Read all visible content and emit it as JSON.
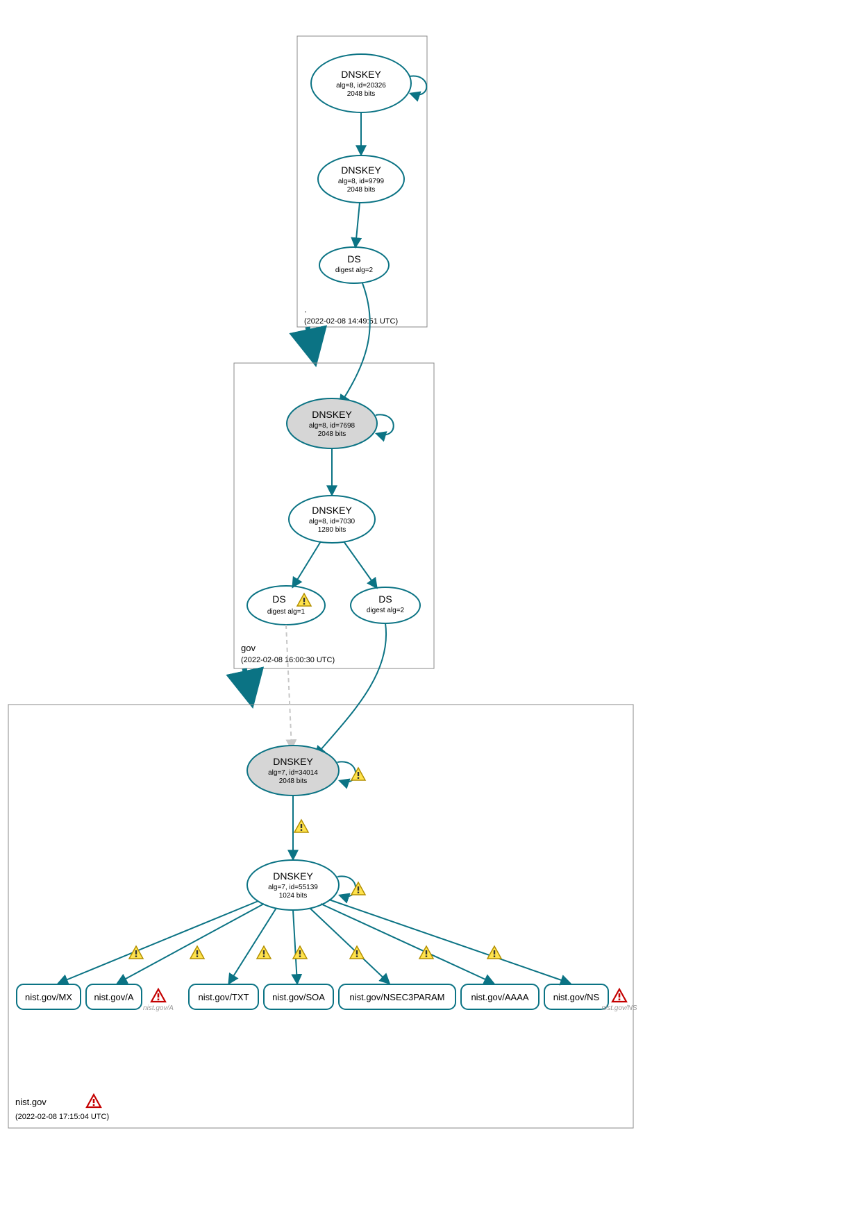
{
  "colors": {
    "line": "#0b7384",
    "shade": "#d6d6d6"
  },
  "zones": {
    "root": {
      "label": ".",
      "timestamp": "(2022-02-08 14:49:51 UTC)"
    },
    "gov": {
      "label": "gov",
      "timestamp": "(2022-02-08 16:00:30 UTC)"
    },
    "nist": {
      "label": "nist.gov",
      "timestamp": "(2022-02-08 17:15:04 UTC)"
    }
  },
  "nodes": {
    "root_ksk": {
      "title": "DNSKEY",
      "sub1": "alg=8, id=20326",
      "sub2": "2048 bits"
    },
    "root_zsk": {
      "title": "DNSKEY",
      "sub1": "alg=8, id=9799",
      "sub2": "2048 bits"
    },
    "root_ds": {
      "title": "DS",
      "sub1": "digest alg=2"
    },
    "gov_ksk": {
      "title": "DNSKEY",
      "sub1": "alg=8, id=7698",
      "sub2": "2048 bits"
    },
    "gov_zsk": {
      "title": "DNSKEY",
      "sub1": "alg=8, id=7030",
      "sub2": "1280 bits"
    },
    "gov_ds1": {
      "title": "DS",
      "sub1": "digest alg=1"
    },
    "gov_ds2": {
      "title": "DS",
      "sub1": "digest alg=2"
    },
    "nist_ksk": {
      "title": "DNSKEY",
      "sub1": "alg=7, id=34014",
      "sub2": "2048 bits"
    },
    "nist_zsk": {
      "title": "DNSKEY",
      "sub1": "alg=7, id=55139",
      "sub2": "1024 bits"
    }
  },
  "leaves": {
    "mx": "nist.gov/MX",
    "a": "nist.gov/A",
    "txt": "nist.gov/TXT",
    "soa": "nist.gov/SOA",
    "nsec": "nist.gov/NSEC3PARAM",
    "aaaa": "nist.gov/AAAA",
    "ns": "nist.gov/NS"
  },
  "ghosts": {
    "a": "nist.gov/A",
    "ns": "nist.gov/NS"
  },
  "icons": {
    "warn": "warning-icon",
    "err": "error-icon"
  }
}
